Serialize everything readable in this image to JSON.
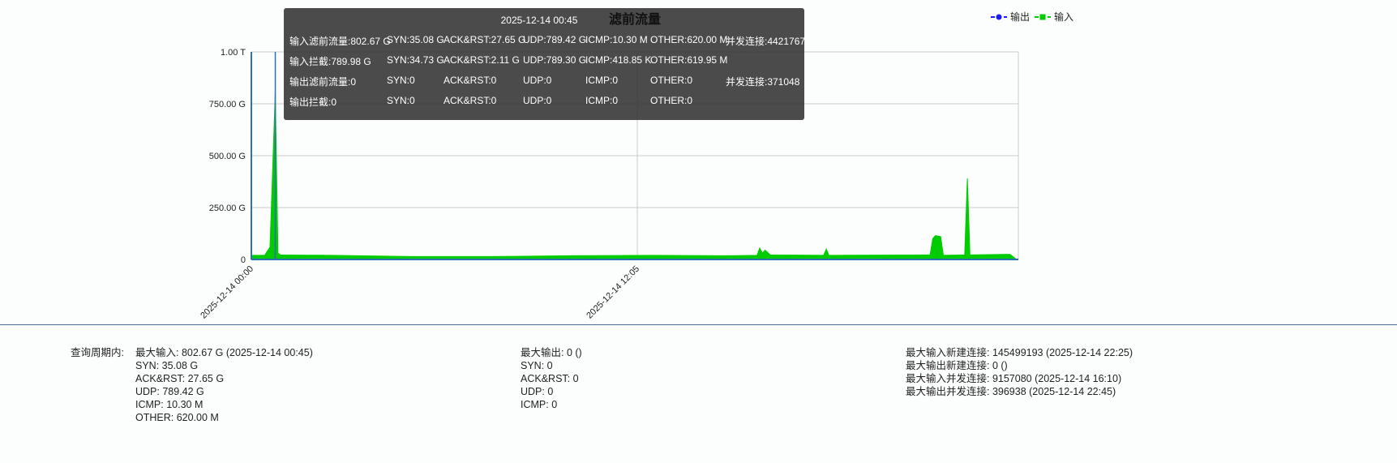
{
  "chart_data": {
    "type": "area",
    "title": "滤前流量",
    "legend": [
      {
        "name": "输出",
        "color": "#1a1aff"
      },
      {
        "name": "输入",
        "color": "#00cc00"
      }
    ],
    "legend_placement": "top-right",
    "yticks": [
      "0",
      "250.00 G",
      "500.00 G",
      "750.00 G",
      "1.00 T"
    ],
    "ylim_G": [
      0,
      1000
    ],
    "xticks": [
      {
        "label": "2025-12-14 00:00",
        "index": 0
      },
      {
        "label": "2025-12-14 12:05",
        "index": 145
      }
    ],
    "x_interval_minutes": 5,
    "series": [
      {
        "name": "输入",
        "unit": "G",
        "points": [
          [
            0,
            20
          ],
          [
            5,
            20
          ],
          [
            7,
            60
          ],
          [
            9,
            802.67
          ],
          [
            10,
            30
          ],
          [
            11,
            22
          ],
          [
            30,
            20
          ],
          [
            60,
            14
          ],
          [
            90,
            14
          ],
          [
            120,
            18
          ],
          [
            150,
            20
          ],
          [
            180,
            18
          ],
          [
            190,
            20
          ],
          [
            191,
            55
          ],
          [
            192,
            30
          ],
          [
            193,
            45
          ],
          [
            195,
            22
          ],
          [
            215,
            20
          ],
          [
            216,
            50
          ],
          [
            217,
            20
          ],
          [
            255,
            22
          ],
          [
            256,
            100
          ],
          [
            257,
            115
          ],
          [
            259,
            110
          ],
          [
            260,
            20
          ],
          [
            268,
            22
          ],
          [
            269,
            390
          ],
          [
            270,
            22
          ],
          [
            285,
            25
          ],
          [
            287,
            5
          ]
        ]
      },
      {
        "name": "输出",
        "unit": "G",
        "points": [
          [
            0,
            0
          ],
          [
            287,
            0
          ]
        ]
      }
    ],
    "hover_index": 9
  },
  "tooltip": {
    "time": "2025-12-14 00:45",
    "rows": [
      [
        "输入滤前流量:802.67 G",
        "SYN:35.08 G",
        "ACK&RST:27.65 G",
        "UDP:789.42 G",
        "ICMP:10.30 M",
        "OTHER:620.00 M",
        "并发连接:4421767"
      ],
      [
        "输入拦截:789.98 G",
        "SYN:34.73 G",
        "ACK&RST:2.11 G",
        "UDP:789.30 G",
        "ICMP:418.85 K",
        "OTHER:619.95 M",
        ""
      ],
      [
        "输出滤前流量:0",
        "SYN:0",
        "ACK&RST:0",
        "UDP:0",
        "ICMP:0",
        "OTHER:0",
        "并发连接:371048"
      ],
      [
        "输出拦截:0",
        "SYN:0",
        "ACK&RST:0",
        "UDP:0",
        "ICMP:0",
        "OTHER:0",
        ""
      ]
    ]
  },
  "summary": {
    "label": "查询周期内:",
    "col1": [
      "最大输入: 802.67 G (2025-12-14 00:45)",
      "SYN: 35.08 G",
      "ACK&RST: 27.65 G",
      "UDP: 789.42 G",
      "ICMP: 10.30 M",
      "OTHER: 620.00 M"
    ],
    "col2": [
      "最大输出: 0 ()",
      "SYN: 0",
      "ACK&RST: 0",
      "UDP: 0",
      "ICMP: 0"
    ],
    "col3": [
      "最大输入新建连接: 145499193 (2025-12-14 22:25)",
      "最大输出新建连接: 0 ()",
      "最大输入并发连接: 9157080 (2025-12-14 16:10)",
      "最大输出并发连接: 396938 (2025-12-14 22:45)"
    ]
  }
}
